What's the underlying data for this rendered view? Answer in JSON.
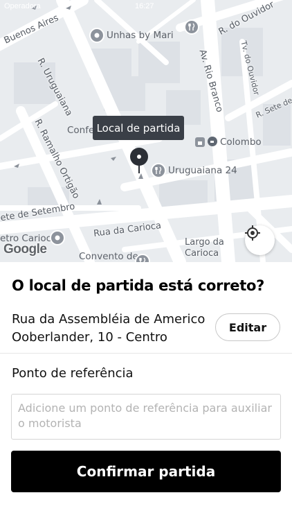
{
  "status_bar": {
    "carrier": "Operadora",
    "time": "16:27"
  },
  "map": {
    "streets": [
      "Buenos Aires",
      "R. Uruguaiana",
      "R. do Ouvidor",
      "Tv. do Ouvidor",
      "Av. Rio Branco",
      "R. Sete de",
      "R. Ramalho Ortigão",
      "ete de Setembro",
      "Rua da Carioca",
      "Largo da Carioca"
    ],
    "pois": [
      {
        "name": "Unhas by Mari",
        "icon": "place-pin-icon"
      },
      {
        "name": "Colombo",
        "icon": "cafe-icon"
      },
      {
        "name": "Uruguaiana 24",
        "icon": "restaurant-icon"
      },
      {
        "name": "etro Carioca",
        "icon": "place-pin-icon"
      },
      {
        "name": "Convento de",
        "icon": "restaurant-icon"
      },
      {
        "name": "Confe",
        "icon": ""
      }
    ],
    "pickup_tooltip": "Local de partida",
    "attribution": "Google"
  },
  "sheet": {
    "question": "O local de partida está correto?",
    "address_line1": "Rua da Assembléia de Americo",
    "address_line2": "Ooberlander, 10 - Centro",
    "edit_label": "Editar",
    "reference_label": "Ponto de referência",
    "reference_placeholder": "Adicione um ponto de referência para auxiliar o motorista",
    "reference_value": "",
    "confirm_label": "Confirmar partida"
  },
  "colors": {
    "primary_button": "#000000",
    "tooltip_bg": "#3a3f47",
    "map_bg": "#e9ecef"
  }
}
